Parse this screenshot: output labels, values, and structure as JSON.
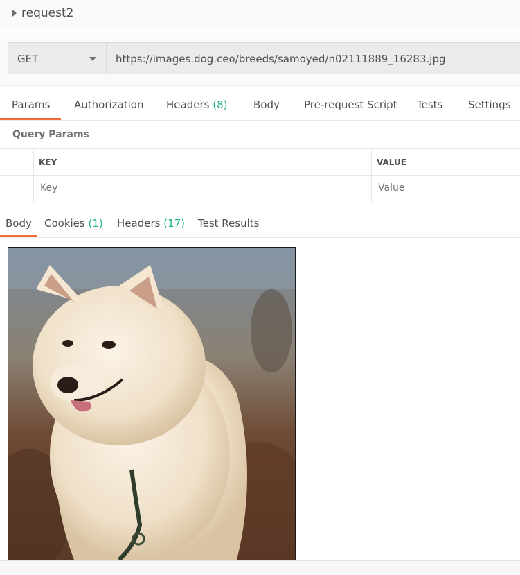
{
  "request": {
    "name": "request2"
  },
  "url_bar": {
    "method": "GET",
    "url": "https://images.dog.ceo/breeds/samoyed/n02111889_16283.jpg"
  },
  "request_tabs": [
    {
      "label": "Params",
      "count": ""
    },
    {
      "label": "Authorization",
      "count": ""
    },
    {
      "label": "Headers",
      "count": "(8)"
    },
    {
      "label": "Body",
      "count": ""
    },
    {
      "label": "Pre-request Script",
      "count": ""
    },
    {
      "label": "Tests",
      "count": ""
    },
    {
      "label": "Settings",
      "count": ""
    }
  ],
  "query_params": {
    "title": "Query Params",
    "key_header": "KEY",
    "value_header": "VALUE",
    "key_placeholder": "Key",
    "value_placeholder": "Value"
  },
  "response_tabs": [
    {
      "label": "Body",
      "count": ""
    },
    {
      "label": "Cookies",
      "count": "(1)"
    },
    {
      "label": "Headers",
      "count": "(17)"
    },
    {
      "label": "Test Results",
      "count": ""
    }
  ],
  "colors": {
    "accent": "#f26b3a",
    "count_green": "#26b47f"
  },
  "response_body": {
    "image_subject": "white-samoyed-dog-photo"
  }
}
